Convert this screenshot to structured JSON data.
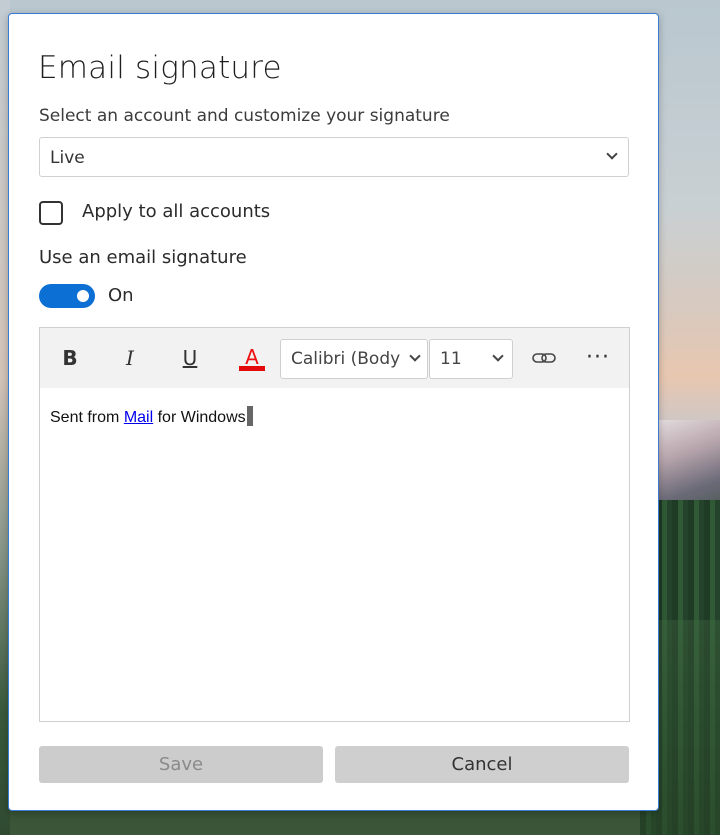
{
  "dialog": {
    "title": "Email signature",
    "subtitle": "Select an account and customize your signature"
  },
  "account": {
    "selected": "Live"
  },
  "apply_all": {
    "label": "Apply to all accounts",
    "checked": false
  },
  "signature_toggle": {
    "label": "Use an email signature",
    "state": "On",
    "on": true
  },
  "toolbar": {
    "bold": "B",
    "italic": "I",
    "underline": "U",
    "font_color": "A",
    "font_color_hex": "#e20a0a",
    "font": "Calibri (Body)",
    "size": "11",
    "link_icon": "link-icon",
    "more_icon": "more-icon",
    "more": "···"
  },
  "editor": {
    "text_before": "Sent from ",
    "link_text": "Mail",
    "text_after": " for Windows"
  },
  "buttons": {
    "save": "Save",
    "cancel": "Cancel"
  },
  "colors": {
    "accent": "#0b6fd3",
    "border": "#3a7bd5"
  }
}
